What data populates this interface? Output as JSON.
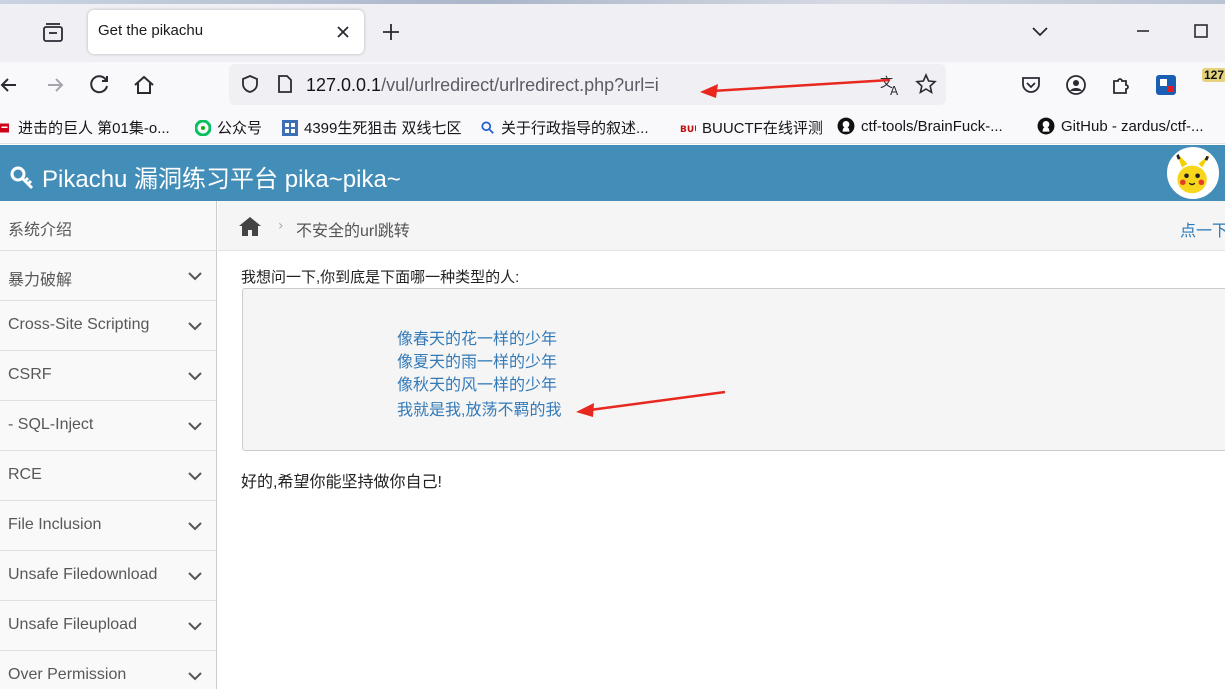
{
  "browser": {
    "tab": {
      "title": "Get the pikachu"
    },
    "url": {
      "host": "127.0.0.1",
      "path": "/vul/urlredirect/urlredirect.php?url=i"
    },
    "extension_badge": "127",
    "bookmarks": [
      {
        "label": "进击的巨人 第01集-o...",
        "icon": "video-icon"
      },
      {
        "label": "公众号",
        "icon": "wechat-icon"
      },
      {
        "label": "4399生死狙击 双线七区",
        "icon": "game-icon"
      },
      {
        "label": "关于行政指导的叙述...",
        "icon": "search-icon"
      },
      {
        "label": "BUUCTF在线评测",
        "icon": "buuctf-icon"
      },
      {
        "label": "ctf-tools/BrainFuck-...",
        "icon": "github-icon"
      },
      {
        "label": "GitHub - zardus/ctf-...",
        "icon": "github-icon"
      }
    ]
  },
  "site": {
    "title": "Pikachu 漏洞练习平台 pika~pika~"
  },
  "sidebar": {
    "items": [
      {
        "label": "系统介绍",
        "has_chevron": false
      },
      {
        "label": "暴力破解",
        "has_chevron": true
      },
      {
        "label": "Cross-Site Scripting",
        "has_chevron": true
      },
      {
        "label": "CSRF",
        "has_chevron": true
      },
      {
        "label": "- SQL-Inject",
        "has_chevron": true
      },
      {
        "label": "RCE",
        "has_chevron": true
      },
      {
        "label": "File Inclusion",
        "has_chevron": true
      },
      {
        "label": "Unsafe Filedownload",
        "has_chevron": true
      },
      {
        "label": "Unsafe Fileupload",
        "has_chevron": true
      },
      {
        "label": "Over Permission",
        "has_chevron": true
      }
    ]
  },
  "breadcrumb": {
    "current": "不安全的url跳转",
    "help_link": "点一下"
  },
  "main": {
    "question": "我想问一下,你到底是下面哪一种类型的人:",
    "options": [
      "像春天的花一样的少年",
      "像夏天的雨一样的少年",
      "像秋天的风一样的少年",
      "我就是我,放荡不羁的我"
    ],
    "result": "好的,希望你能坚持做你自己!"
  },
  "colors": {
    "header_bg": "#438eb9",
    "link": "#337ab7",
    "annotation_arrow": "#e8281e"
  }
}
